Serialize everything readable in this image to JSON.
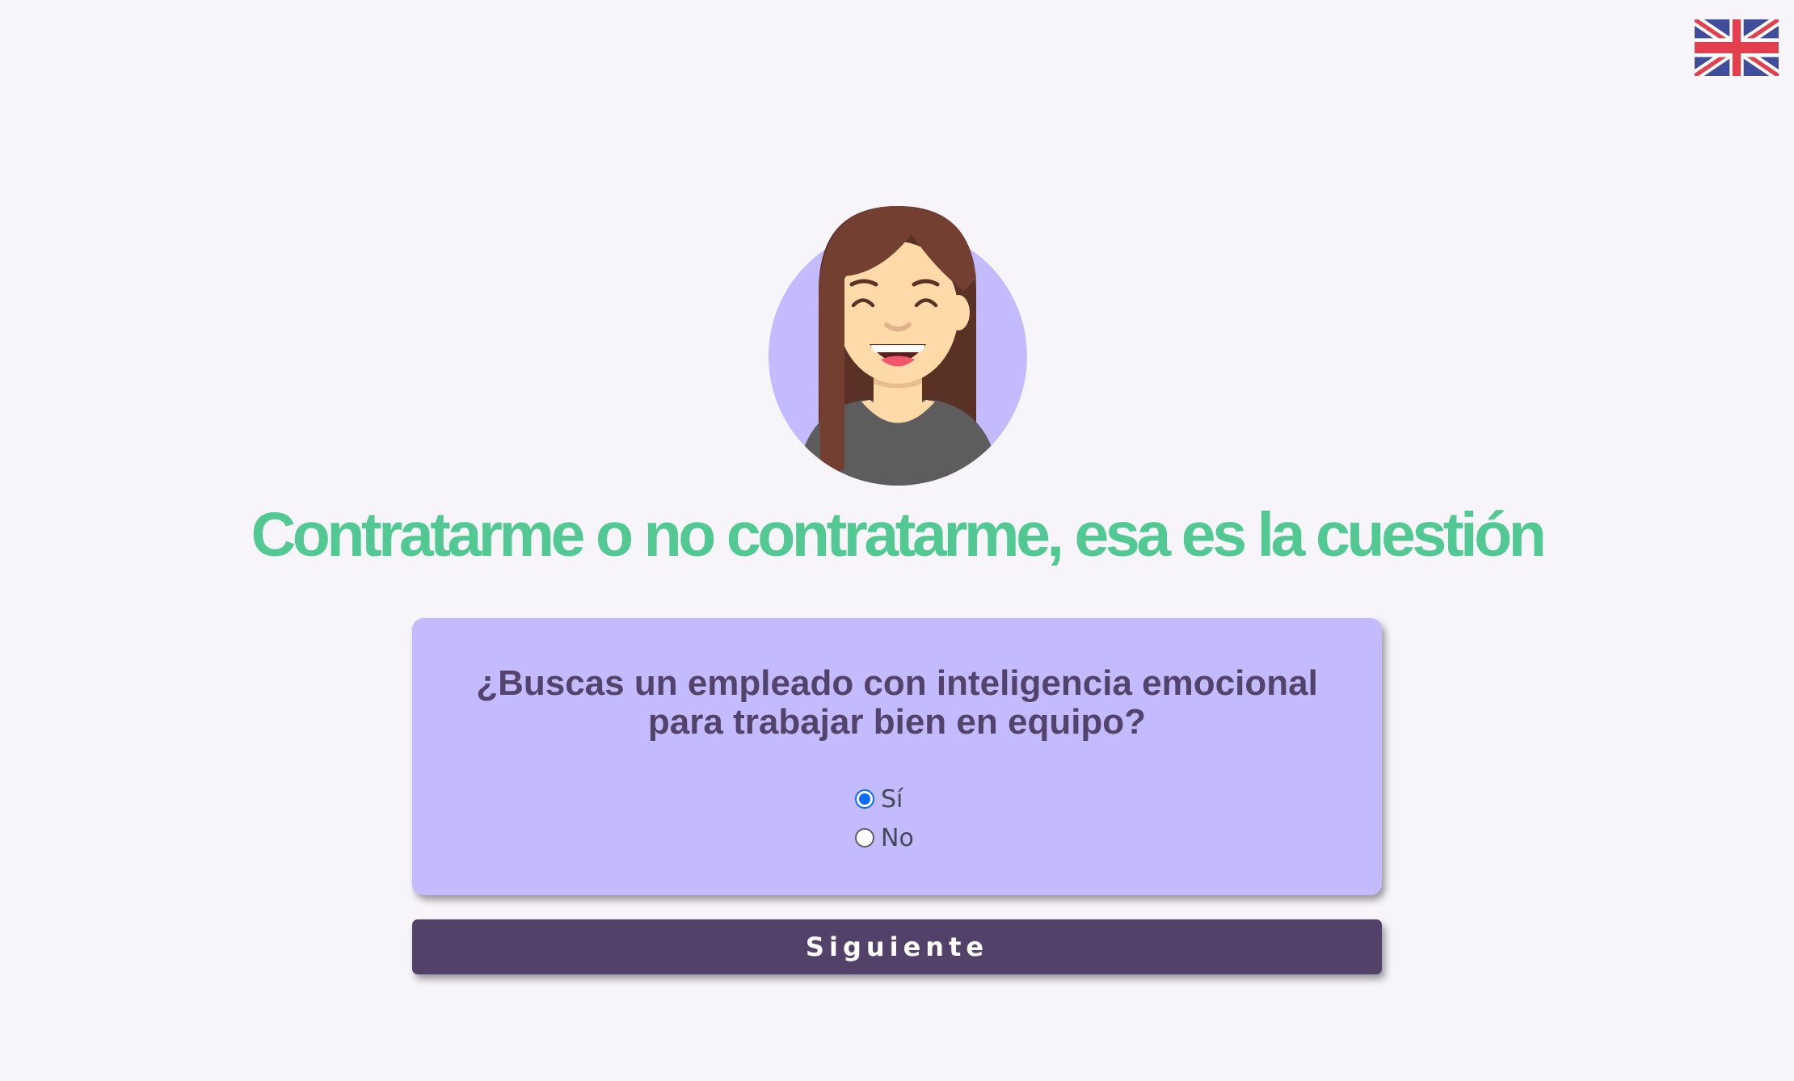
{
  "language_switch": {
    "icon": "uk-flag-icon"
  },
  "avatar": {
    "icon": "smiling-woman-avatar",
    "background_color": "#c3bbfd",
    "hair_color": "#723f31",
    "skin_color": "#fddaa8",
    "shirt_color": "#5d5d5d"
  },
  "title": "Contratarme o no contratarme, esa es la cuestión",
  "question": {
    "text": "¿Buscas un empleado con inteligencia emocional para trabajar bien en equipo?",
    "options": [
      {
        "label": "Sí",
        "selected": true
      },
      {
        "label": "No",
        "selected": false
      }
    ]
  },
  "next_button": {
    "label": "Siguiente"
  },
  "colors": {
    "page_background": "#f7f5fa",
    "title": "#52c993",
    "card_background": "#c3bbfd",
    "question_text": "#52436a",
    "button_background": "#52426a",
    "button_text": "#ffffff",
    "radio_selected": "#0a6cff"
  }
}
